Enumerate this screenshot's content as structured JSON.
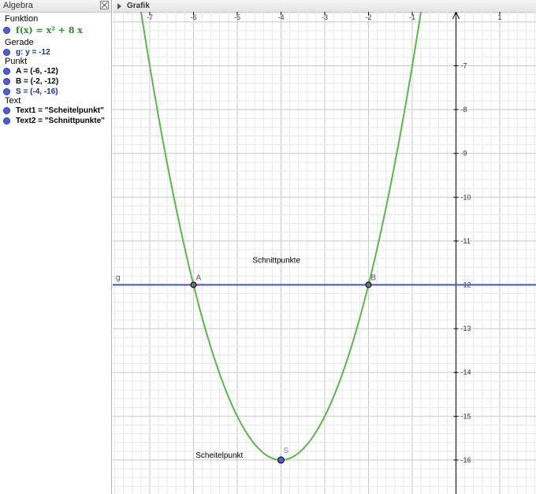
{
  "algebra": {
    "title": "Algebra",
    "categories": {
      "funktion": "Funktion",
      "gerade": "Gerade",
      "punkt": "Punkt",
      "text": "Text"
    },
    "items": {
      "f": "f(x) = x² + 8 x",
      "g": "g: y = -12",
      "A": "A = (-6, -12)",
      "B": "B = (-2, -12)",
      "S": "S = (-4, -16)",
      "text1": "Text1 = \"Scheitelpunkt\"",
      "text2": "Text2 = \"Schnittpunkte\""
    }
  },
  "graphics": {
    "title": "Grafik",
    "x_ticks": [
      "-7",
      "-6",
      "-5",
      "-4",
      "-3",
      "-2",
      "-1",
      "1"
    ],
    "y_ticks": [
      "-7",
      "-8",
      "-9",
      "-10",
      "-11",
      "-12",
      "-13",
      "-14",
      "-15",
      "-16"
    ],
    "labels": {
      "g": "g",
      "A": "A",
      "B": "B",
      "S": "S",
      "schnittpunkte": "Schnittpunkte",
      "scheitelpunkt": "Scheitelpunkt"
    },
    "colors": {
      "parabola": "#5ab74a",
      "line": "#4a52c4",
      "point_fill": "#4f5ed8",
      "grid_minor": "#e8e8e8",
      "grid_major": "#c8c8c8"
    }
  },
  "chart_data": {
    "type": "line",
    "series": [
      {
        "name": "f",
        "formula": "x^2 + 8x"
      },
      {
        "name": "g",
        "formula": "y = -12"
      }
    ],
    "points": [
      {
        "name": "A",
        "x": -6,
        "y": -12
      },
      {
        "name": "B",
        "x": -2,
        "y": -12
      },
      {
        "name": "S",
        "x": -4,
        "y": -16
      }
    ],
    "xlim": [
      -7.75,
      1.9
    ],
    "ylim": [
      -16.7,
      -6.0
    ],
    "grid": true
  }
}
